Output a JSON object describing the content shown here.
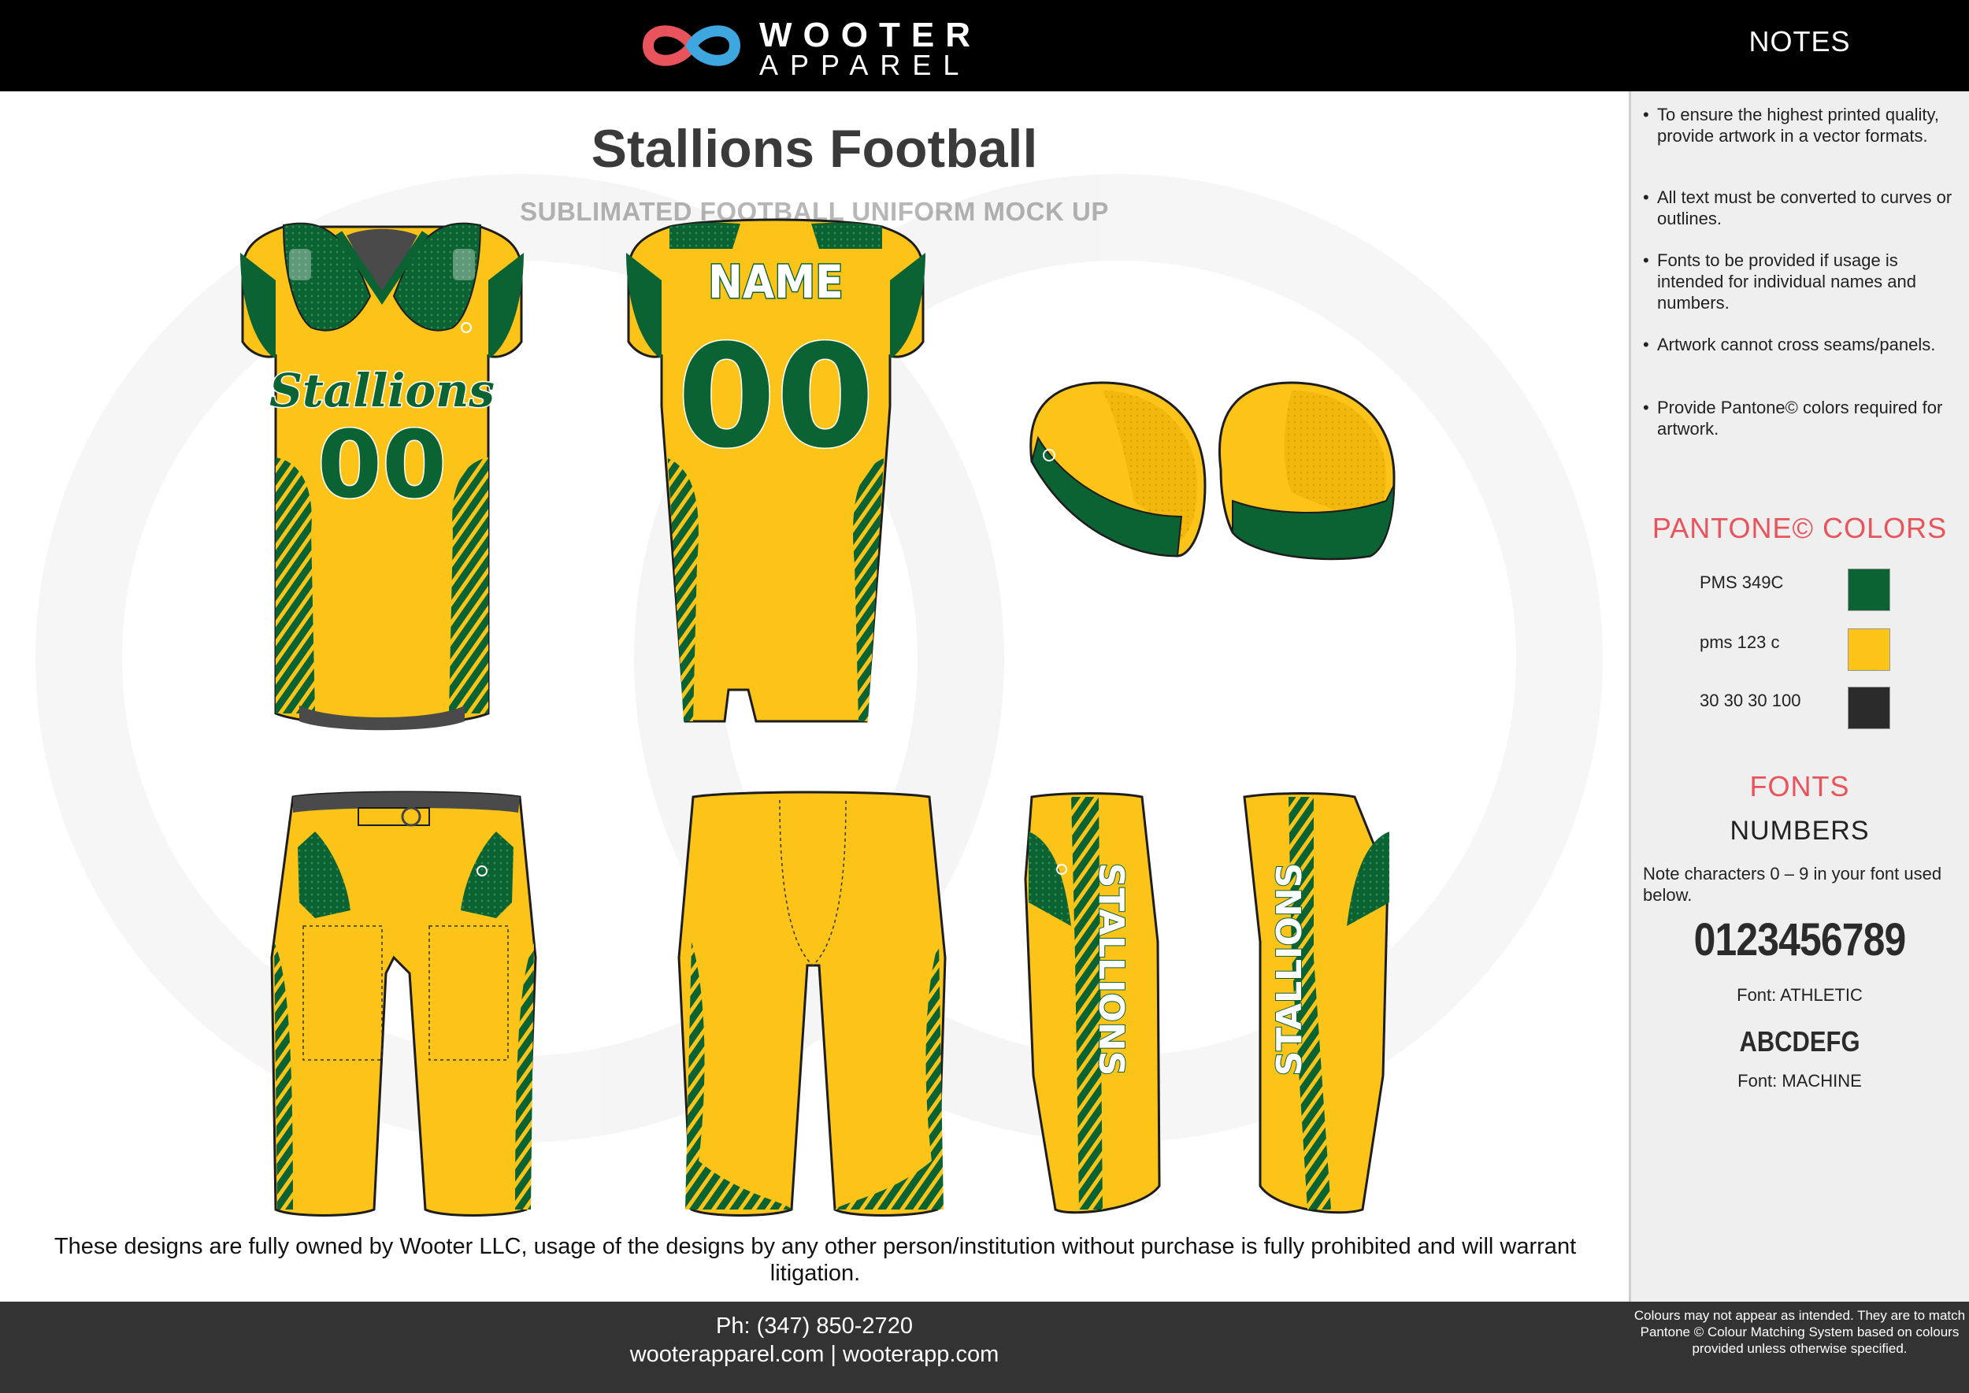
{
  "header": {
    "brand_line1": "WOOTER",
    "brand_line2": "APPAREL",
    "notes_title": "NOTES"
  },
  "main": {
    "title": "Stallions Football",
    "subtitle": "SUBLIMATED FOOTBALL UNIFORM MOCK UP",
    "disclaimer": "These designs are fully owned by Wooter LLC, usage of the designs by any other person/institution without purchase is fully prohibited and will warrant litigation."
  },
  "artwork_text": {
    "front_script": "Stallions",
    "front_number": "00",
    "back_name": "NAME",
    "back_number": "00",
    "pants_side_text": "STALLIONS"
  },
  "notes": [
    "To ensure the highest printed quality, provide artwork in  a vector formats.",
    "All text must be converted to curves or outlines.",
    "Fonts to be provided if usage is intended for individual names and numbers.",
    "Artwork cannot cross seams/panels.",
    "Provide Pantone© colors required for artwork."
  ],
  "pantone": {
    "title": "PANTONE©  COLORS",
    "colors": [
      {
        "label": "PMS 349C",
        "hex": "#0b6334"
      },
      {
        "label": "pms 123 c",
        "hex": "#fcc419"
      },
      {
        "label": "30 30 30 100",
        "hex": "#2b2b2b"
      }
    ]
  },
  "fonts": {
    "title": "FONTS",
    "numbers_heading": "NUMBERS",
    "note": "Note characters 0 – 9 in your font used below.",
    "sample_digits": "0123456789",
    "digits_font_label": "Font: ATHLETIC",
    "sample_letters": "ABCDEFG",
    "letters_font_label": "Font: MACHINE"
  },
  "footer": {
    "phone": "Ph: (347) 850-2720",
    "websites": "wooterapparel.com | wooterapp.com",
    "colour_note": "Colours may not appear as intended. They are to match Pantone © Colour Matching System based on colours provided unless otherwise specified."
  },
  "colors": {
    "green": "#0b6334",
    "gold": "#fcc419",
    "outline": "#1d1d1d",
    "accent_red": "#e9535c",
    "logo_red": "#e9535c",
    "logo_blue": "#3ea7e0"
  },
  "icons": [
    "wooter-logo-icon"
  ]
}
